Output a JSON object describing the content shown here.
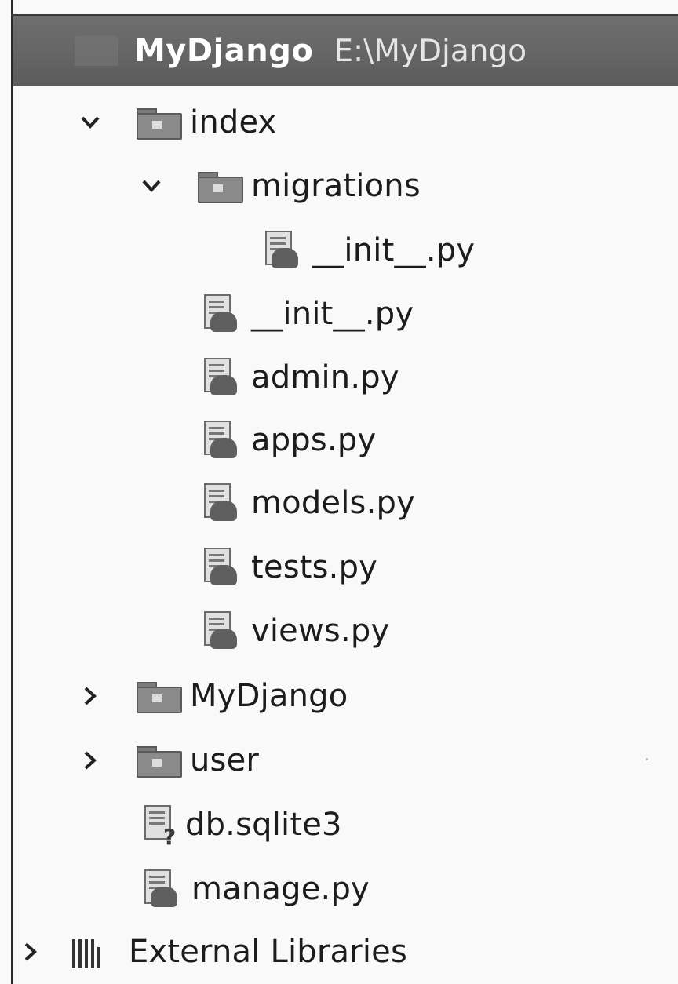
{
  "project": {
    "name": "MyDjango",
    "path": "E:\\MyDjango"
  },
  "tree": {
    "index": {
      "label": "index"
    },
    "migrations": {
      "label": "migrations"
    },
    "migrations_init": {
      "label": "__init__.py"
    },
    "index_init": {
      "label": "__init__.py"
    },
    "admin": {
      "label": "admin.py"
    },
    "apps": {
      "label": "apps.py"
    },
    "models": {
      "label": "models.py"
    },
    "tests": {
      "label": "tests.py"
    },
    "views": {
      "label": "views.py"
    },
    "mydjango": {
      "label": "MyDjango"
    },
    "user": {
      "label": "user"
    },
    "db": {
      "label": "db.sqlite3"
    },
    "manage": {
      "label": "manage.py"
    },
    "external_libraries": {
      "label": "External Libraries"
    }
  },
  "icons": {
    "folder": "folder-icon",
    "python_file": "python-file-icon",
    "database_file": "database-file-icon",
    "libraries": "libraries-icon",
    "expanded": "chevron-down-icon",
    "collapsed": "chevron-right-icon"
  }
}
